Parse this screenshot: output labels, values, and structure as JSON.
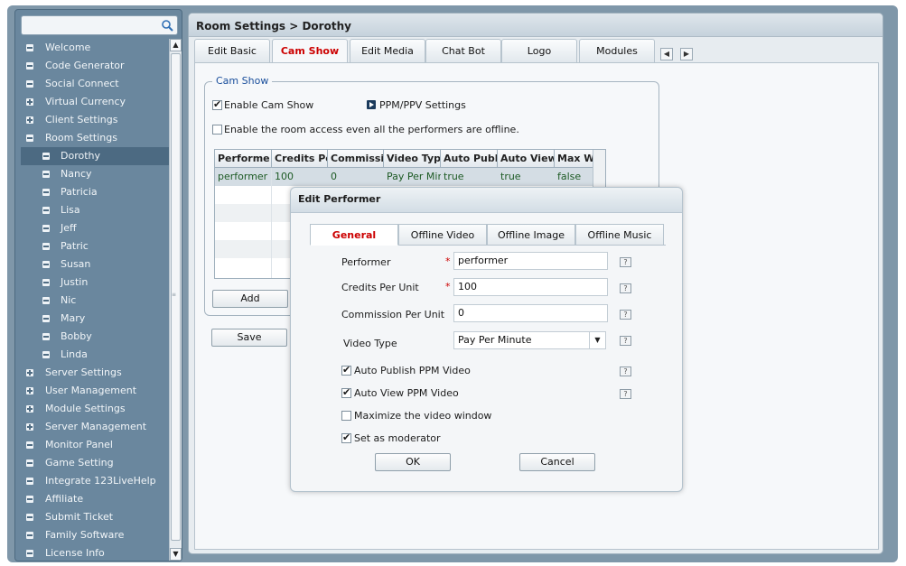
{
  "search": {
    "placeholder": ""
  },
  "sidebar": {
    "items": [
      {
        "label": "Welcome",
        "level": 0,
        "icon": "collapse-icon"
      },
      {
        "label": "Code Generator",
        "level": 0,
        "icon": "collapse-icon"
      },
      {
        "label": "Social Connect",
        "level": 0,
        "icon": "collapse-icon"
      },
      {
        "label": "Virtual Currency",
        "level": 0,
        "icon": "expand-icon"
      },
      {
        "label": "Client Settings",
        "level": 0,
        "icon": "expand-icon"
      },
      {
        "label": "Room Settings",
        "level": 0,
        "icon": "collapse-icon"
      },
      {
        "label": "Dorothy",
        "level": 1,
        "icon": "collapse-icon",
        "selected": true
      },
      {
        "label": "Nancy",
        "level": 1,
        "icon": "collapse-icon"
      },
      {
        "label": "Patricia",
        "level": 1,
        "icon": "collapse-icon"
      },
      {
        "label": "Lisa",
        "level": 1,
        "icon": "collapse-icon"
      },
      {
        "label": "Jeff",
        "level": 1,
        "icon": "collapse-icon"
      },
      {
        "label": "Patric",
        "level": 1,
        "icon": "collapse-icon"
      },
      {
        "label": "Susan",
        "level": 1,
        "icon": "collapse-icon"
      },
      {
        "label": "Justin",
        "level": 1,
        "icon": "collapse-icon"
      },
      {
        "label": "Nic",
        "level": 1,
        "icon": "collapse-icon"
      },
      {
        "label": "Mary",
        "level": 1,
        "icon": "collapse-icon"
      },
      {
        "label": "Bobby",
        "level": 1,
        "icon": "collapse-icon"
      },
      {
        "label": "Linda",
        "level": 1,
        "icon": "collapse-icon"
      },
      {
        "label": "Server Settings",
        "level": 0,
        "icon": "expand-icon"
      },
      {
        "label": "User Management",
        "level": 0,
        "icon": "expand-icon"
      },
      {
        "label": "Module Settings",
        "level": 0,
        "icon": "expand-icon"
      },
      {
        "label": "Server Management",
        "level": 0,
        "icon": "expand-icon"
      },
      {
        "label": "Monitor Panel",
        "level": 0,
        "icon": "collapse-icon"
      },
      {
        "label": "Game Setting",
        "level": 0,
        "icon": "collapse-icon"
      },
      {
        "label": "Integrate 123LiveHelp",
        "level": 0,
        "icon": "collapse-icon"
      },
      {
        "label": "Affiliate",
        "level": 0,
        "icon": "collapse-icon"
      },
      {
        "label": "Submit Ticket",
        "level": 0,
        "icon": "collapse-icon"
      },
      {
        "label": "Family Software",
        "level": 0,
        "icon": "collapse-icon"
      },
      {
        "label": "License Info",
        "level": 0,
        "icon": "collapse-icon"
      }
    ]
  },
  "header": {
    "title": "Room Settings  > Dorothy"
  },
  "tabs": [
    {
      "label": "Edit Basic"
    },
    {
      "label": "Cam Show",
      "active": true
    },
    {
      "label": "Edit Media"
    },
    {
      "label": "Chat Bot"
    },
    {
      "label": "Logo"
    },
    {
      "label": "Modules"
    }
  ],
  "cam_show": {
    "legend": "Cam Show",
    "enable_label": "Enable Cam Show",
    "enable_checked": true,
    "ppm_label": "PPM/PPV Settings",
    "offline_access_label": "Enable the room access even all the performers are offline.",
    "offline_access_checked": false,
    "grid": {
      "columns": [
        "Performe",
        "Credits Pe",
        "Commissi",
        "Video Typ",
        "Auto Publ",
        "Auto View",
        "Max W"
      ],
      "rows": [
        [
          "performer",
          "100",
          "0",
          "Pay Per Min",
          "true",
          "true",
          "false"
        ]
      ]
    },
    "add_label": "Add",
    "save_label": "Save"
  },
  "dialog": {
    "title": "Edit Performer",
    "tabs": [
      {
        "label": "General",
        "active": true
      },
      {
        "label": "Offline Video"
      },
      {
        "label": "Offline Image"
      },
      {
        "label": "Offline Music"
      }
    ],
    "fields": {
      "performer": {
        "label": "Performer",
        "value": "performer",
        "required": true
      },
      "credits": {
        "label": "Credits Per Unit",
        "value": "100",
        "required": true
      },
      "commission": {
        "label": "Commission Per Unit",
        "value": "0"
      },
      "video_type": {
        "label": "Video Type",
        "value": "Pay Per Minute"
      }
    },
    "checks": {
      "auto_publish": {
        "label": "Auto Publish PPM Video",
        "checked": true
      },
      "auto_view": {
        "label": "Auto View PPM Video",
        "checked": true
      },
      "maximize": {
        "label": "Maximize the video window",
        "checked": false
      },
      "moderator": {
        "label": "Set as moderator",
        "checked": true
      }
    },
    "required_mark": "*",
    "help_glyph": "?",
    "ok_label": "OK",
    "cancel_label": "Cancel"
  },
  "colors": {
    "accent": "#cc0000",
    "link": "#1a4f9c",
    "sidebar_bg": "#6a879e"
  }
}
